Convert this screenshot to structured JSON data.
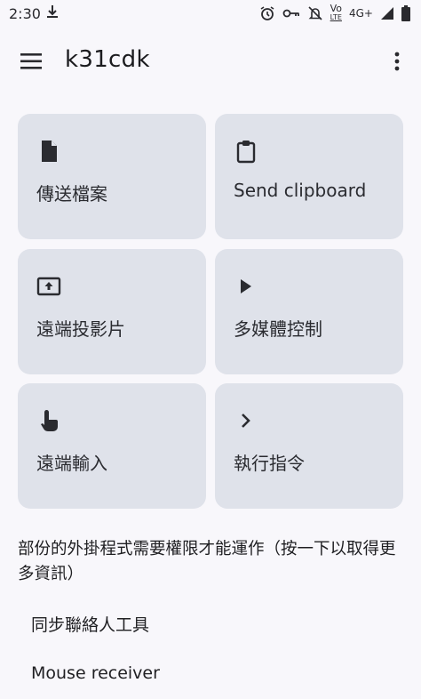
{
  "status_bar": {
    "time": "2:30",
    "volte": "Vo",
    "lte": "LTE",
    "network": "4G+",
    "icons": [
      "download-icon",
      "alarm-icon",
      "vpn-key-icon",
      "notifications-off-icon",
      "volte-icon",
      "signal-icon",
      "battery-icon"
    ]
  },
  "app_bar": {
    "title": "k31cdk",
    "icons": [
      "menu-icon",
      "more-vert-icon"
    ]
  },
  "actions": [
    {
      "label": "傳送檔案",
      "icon": "file-icon"
    },
    {
      "label": "Send clipboard",
      "icon": "clipboard-icon"
    },
    {
      "label": "遠端投影片",
      "icon": "presentation-icon"
    },
    {
      "label": "多媒體控制",
      "icon": "play-icon"
    },
    {
      "label": "遠端輸入",
      "icon": "touch-icon"
    },
    {
      "label": "執行指令",
      "icon": "chevron-right-icon"
    }
  ],
  "notice": "部份的外掛程式需要權限才能運作（按一下以取得更多資訊）",
  "plugins": [
    "同步聯絡人工具",
    "Mouse receiver"
  ],
  "colors": {
    "background": "#f8f7fb",
    "card": "#dfe2ea",
    "text": "#1f1f22"
  }
}
